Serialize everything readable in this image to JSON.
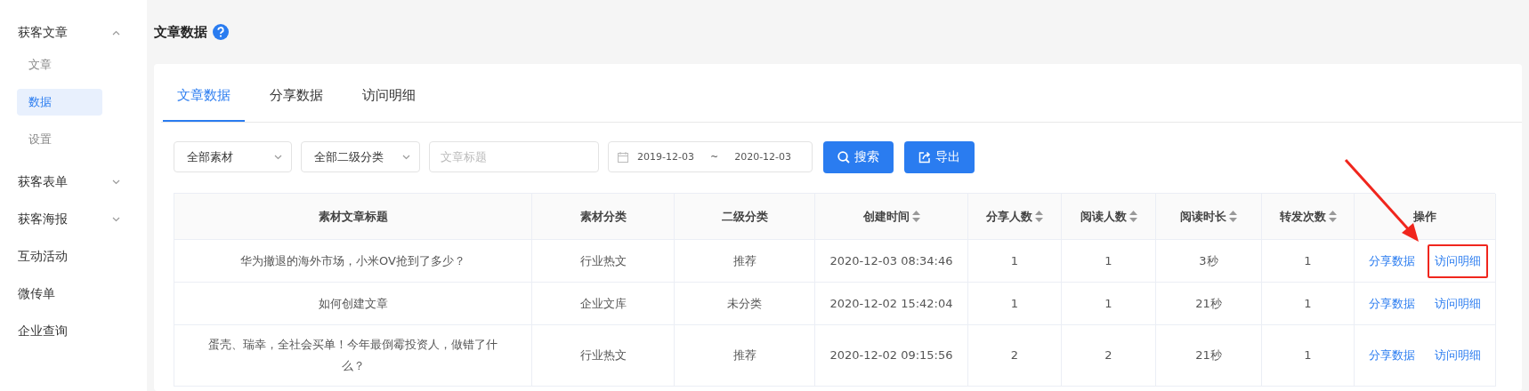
{
  "sidebar": {
    "items": [
      {
        "label": "获客文章",
        "kind": "group",
        "expanded": true,
        "children": [
          {
            "label": "文章",
            "selected": false
          },
          {
            "label": "数据",
            "selected": true
          },
          {
            "label": "设置",
            "selected": false
          }
        ]
      },
      {
        "label": "获客表单",
        "kind": "group",
        "expanded": false
      },
      {
        "label": "获客海报",
        "kind": "group",
        "expanded": false
      },
      {
        "label": "互动活动",
        "kind": "link"
      },
      {
        "label": "微传单",
        "kind": "link"
      },
      {
        "label": "企业查询",
        "kind": "link"
      }
    ]
  },
  "page": {
    "title": "文章数据"
  },
  "tabs": [
    {
      "label": "文章数据",
      "selected": true
    },
    {
      "label": "分享数据",
      "selected": false
    },
    {
      "label": "访问明细",
      "selected": false
    }
  ],
  "filters": {
    "material": {
      "value": "全部素材"
    },
    "category": {
      "value": "全部二级分类"
    },
    "title": {
      "placeholder": "文章标题"
    },
    "date_start": "2019-12-03",
    "date_separator": "~",
    "date_end": "2020-12-03",
    "search_button": "搜索",
    "export_button": "导出"
  },
  "table": {
    "columns": [
      {
        "label": "素材文章标题",
        "sortable": false
      },
      {
        "label": "素材分类",
        "sortable": false
      },
      {
        "label": "二级分类",
        "sortable": false
      },
      {
        "label": "创建时间",
        "sortable": true
      },
      {
        "label": "分享人数",
        "sortable": true
      },
      {
        "label": "阅读人数",
        "sortable": true
      },
      {
        "label": "阅读时长",
        "sortable": true
      },
      {
        "label": "转发次数",
        "sortable": true
      },
      {
        "label": "操作",
        "sortable": false
      }
    ],
    "rows": [
      {
        "cells": [
          "华为撤退的海外市场，小米OV抢到了多少？",
          "行业热文",
          "推荐",
          "2020-12-03 08:34:46",
          "1",
          "1",
          "3秒",
          "1"
        ],
        "actions": [
          {
            "label": "分享数据",
            "highlighted": false
          },
          {
            "label": "访问明细",
            "highlighted": true
          }
        ]
      },
      {
        "cells": [
          "如何创建文章",
          "企业文库",
          "未分类",
          "2020-12-02 15:42:04",
          "1",
          "1",
          "21秒",
          "1"
        ],
        "actions": [
          {
            "label": "分享数据",
            "highlighted": false
          },
          {
            "label": "访问明细",
            "highlighted": false
          }
        ]
      },
      {
        "cells": [
          "蛋壳、瑞幸，全社会买单！今年最倒霉投资人，做错了什么？",
          "行业热文",
          "推荐",
          "2020-12-02 09:15:56",
          "2",
          "2",
          "21秒",
          "1"
        ],
        "actions": [
          {
            "label": "分享数据",
            "highlighted": false
          },
          {
            "label": "访问明细",
            "highlighted": false
          }
        ]
      }
    ]
  }
}
